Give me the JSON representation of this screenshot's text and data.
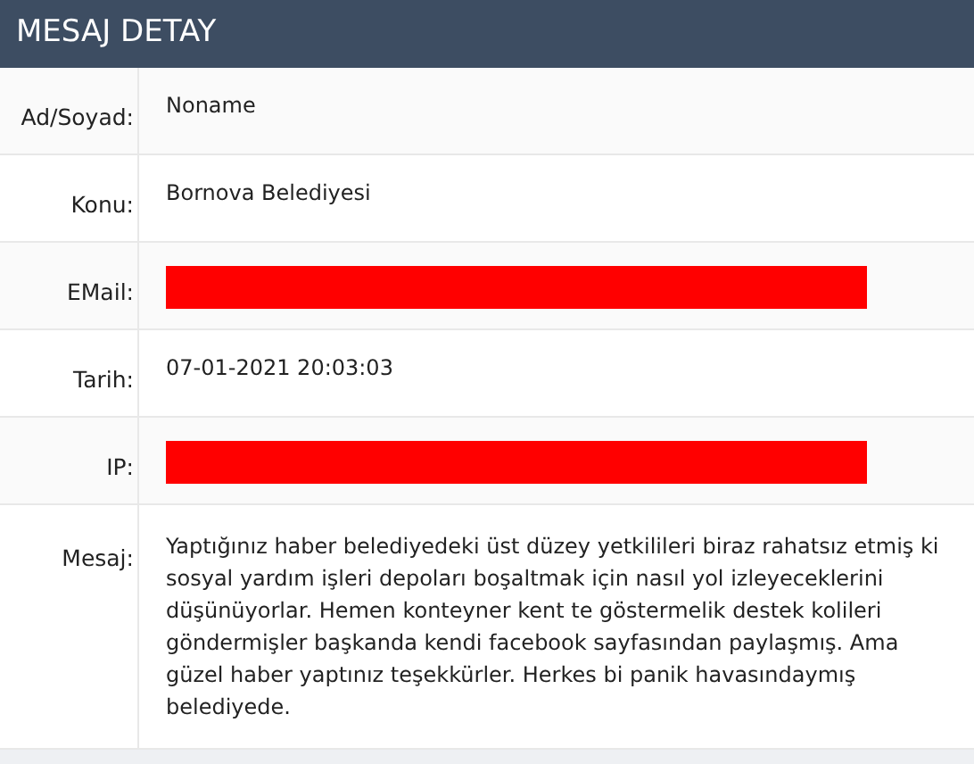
{
  "title": "MESAJ DETAY",
  "rows": [
    {
      "label": "Ad/Soyad:",
      "kind": "text",
      "value": "Noname"
    },
    {
      "label": "Konu:",
      "kind": "text",
      "value": "Bornova Belediyesi"
    },
    {
      "label": "EMail:",
      "kind": "redacted"
    },
    {
      "label": "Tarih:",
      "kind": "text",
      "value": "07-01-2021 20:03:03"
    },
    {
      "label": "IP:",
      "kind": "redacted"
    },
    {
      "label": "Mesaj:",
      "kind": "text",
      "value": "Yaptığınız haber belediyedeki üst düzey yetkilileri biraz rahatsız etmiş ki sosyal yardım işleri depoları boşaltmak için nasıl yol izleyeceklerini düşünüyorlar. Hemen konteyner kent te göstermelik destek kolileri göndermişler başkanda kendi facebook sayfasından paylaşmış. Ama güzel haber yaptınız teşekkürler. Herkes bi panik havasındaymış belediyede."
    }
  ]
}
